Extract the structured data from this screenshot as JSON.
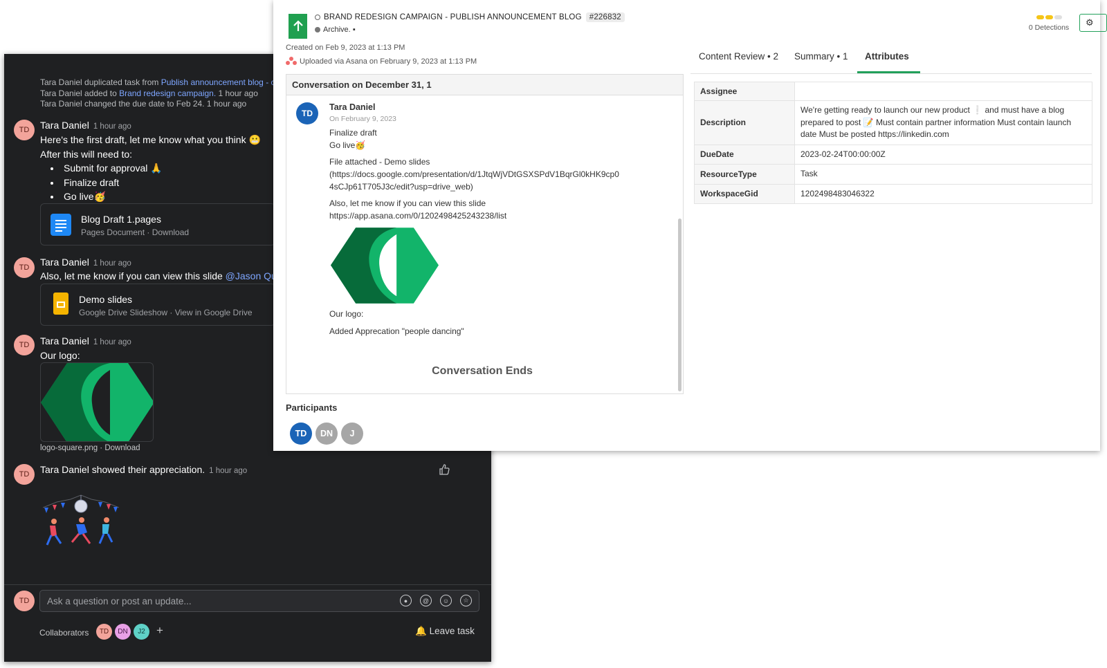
{
  "asana": {
    "activity": [
      {
        "text": "Tara Daniel duplicated task from ",
        "link": "Publish announcement blog - c",
        "suffix": ""
      },
      {
        "text": "Tara Daniel added to ",
        "link": "Brand redesign campaign.",
        "suffix": "   1 hour ago"
      },
      {
        "text": "Tara Daniel changed the due date to Feb 24.",
        "link": "",
        "suffix": "   1 hour ago"
      }
    ],
    "avatar_initials": "TD",
    "msg1": {
      "author": "Tara Daniel",
      "time": "1 hour ago",
      "line1": "Here's the first draft, let me know what you think 😬",
      "line2": "After this will need to:",
      "bullets": [
        "Submit for approval 🙏",
        "Finalize draft",
        "Go live🥳"
      ],
      "attachment": {
        "name": "Blog Draft 1.pages",
        "meta": "Pages Document · Download"
      }
    },
    "msg2": {
      "author": "Tara Daniel",
      "time": "1 hour ago",
      "text": "Also, let me know if you can view this slide ",
      "mention": "@Jason Quin",
      "attachment": {
        "name": "Demo slides",
        "meta": "Google Drive Slideshow · View in Google Drive"
      }
    },
    "msg3": {
      "author": "Tara Daniel",
      "time": "1 hour ago",
      "text": "Our logo:",
      "caption": "logo-square.png · Download"
    },
    "msg4": {
      "author": "Tara Daniel showed their appreciation.",
      "time": "1 hour ago"
    },
    "compose_placeholder": "Ask a question or post an update...",
    "collaborators_label": "Collaborators",
    "collaborators": [
      {
        "initials": "TD",
        "color": "#f3a49b"
      },
      {
        "initials": "DN",
        "color": "#e8a0e6"
      },
      {
        "initials": "J2",
        "color": "#5fd1c7"
      }
    ],
    "leave_label": "Leave task"
  },
  "record": {
    "title": "BRAND REDESIGN CAMPAIGN - PUBLISH ANNOUNCEMENT BLOG",
    "id": "#226832",
    "archive": "Archive.",
    "created": "Created on Feb 9, 2023 at 1:13 PM",
    "uploaded": "Uploaded via Asana on February 9, 2023 at 1:13 PM",
    "detections": "0 Detections",
    "detection_colors": [
      "#f5c518",
      "#f5c518",
      "#e0e0e0"
    ]
  },
  "conversation": {
    "header": "Conversation on December 31, 1",
    "author": "Tara Daniel",
    "initials": "TD",
    "date": "On February 9, 2023",
    "lines": [
      "Finalize draft",
      "Go live🥳",
      "File attached - Demo slides",
      "(https://docs.google.com/presentation/d/1JtqWjVDtGSXSPdV1BqrGl0kHK9cp0",
      "4sCJp61T705J3c/edit?usp=drive_web)",
      "Also, let me know if you can view this slide",
      "https://app.asana.com/0/1202498425243238/list",
      "Our logo:",
      "Added Apprecation \"people dancing\""
    ],
    "ends": "Conversation Ends",
    "participants_label": "Participants",
    "participants": [
      {
        "initials": "TD",
        "color": "#1b64b7"
      },
      {
        "initials": "DN",
        "color": "#a6a6a6"
      },
      {
        "initials": "J",
        "color": "#a6a6a6"
      }
    ]
  },
  "tabs": [
    {
      "label": "Content Review • 2"
    },
    {
      "label": "Summary • 1"
    },
    {
      "label": "Attributes"
    }
  ],
  "attributes": [
    {
      "key": "Assignee",
      "value": ""
    },
    {
      "key": "Description",
      "value": "We're getting ready to launch our new product ❕ and must have a blog prepared to post 📝 Must contain partner information Must contain launch date Must be posted https://linkedin.com"
    },
    {
      "key": "DueDate",
      "value": "2023-02-24T00:00:00Z"
    },
    {
      "key": "ResourceType",
      "value": "Task"
    },
    {
      "key": "WorkspaceGid",
      "value": "1202498483046322"
    }
  ],
  "colors": {
    "accent_green": "#22a05a",
    "logo_dark": "#076b3a",
    "logo_light": "#12b46a"
  }
}
